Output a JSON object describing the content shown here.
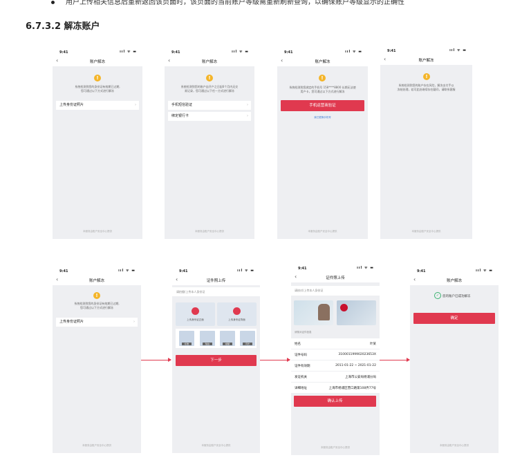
{
  "doc": {
    "bullet_text": "用户上传相关信息后重新返回该页面时，该页面的当前账户等级需重新刷新查询，以确保账户等级显示的正确性",
    "section_heading": "6.7.3.2 解冻账户"
  },
  "common": {
    "time": "9:41",
    "status_icons": "ııl ᯤ ▬",
    "back_icon": "‹",
    "nav_title": "账户解冻",
    "warn_glyph": "!",
    "chevron": "›",
    "footer": "本服务由账户安全中心提供"
  },
  "screens": {
    "s1": {
      "info_l1": "系统检测到您的身份证有效期已过期,",
      "info_l2": "您可通过以下方式进行解冻",
      "row1": "上传身份证照片"
    },
    "s2": {
      "info_l1": "系统检测到您的账户自开户之日起6个月内无交",
      "info_l2": "易记录，您可通过以下任一方式进行解冻",
      "row1": "手机短信验证",
      "row2": "绑定银行卡"
    },
    "s3": {
      "info_l1": "系统检测到您绑定的手机号 158****8800 长期无法使",
      "info_l2": "用户卡，您可通过以下方式进行解冻",
      "button": "手机运营商验证",
      "link": "我已更换手机号"
    },
    "s4": {
      "info_l1": "系统检测到您的账户存在风险，解冻支付手以",
      "info_l2": "冻结处理，若可此处继续存在疑问，请联系客服"
    },
    "s5": {
      "info_l1": "系统检测到您的身份证有效期已过期,",
      "info_l2": "您可通过以下方式进行解冻",
      "row1": "上传身份证照片"
    },
    "s6": {
      "nav_title": "证件照上传",
      "hint": "请拍摄/上传本人身份证",
      "card1": "上传身份证正面",
      "card2": "上传身份证背面",
      "thumbs": [
        "标准",
        "缺边",
        "模糊",
        "闪光"
      ],
      "button": "下一步"
    },
    "s7": {
      "nav_title": "证件照上传",
      "hint": "请核对/上传本人身份证",
      "section": "请核对证件信息",
      "fields": [
        {
          "k": "姓名",
          "v": "叶某"
        },
        {
          "k": "证件号码",
          "v": "310001199902023653X"
        },
        {
          "k": "证件有效期",
          "v": "2011-01-22 ~ 2021-01-22"
        },
        {
          "k": "发证机关",
          "v": "上海市公安局杨浦分局"
        },
        {
          "k": "详细地址",
          "v": "上海市杨浦区营口路第108弄77号"
        }
      ],
      "button": "确认上传"
    },
    "s8": {
      "success": "您的账户已成功解冻",
      "button": "确定"
    }
  },
  "colors": {
    "accent": "#e0394f",
    "warn": "#f4b52a",
    "link": "#3a7bd5",
    "success": "#3cb371"
  }
}
